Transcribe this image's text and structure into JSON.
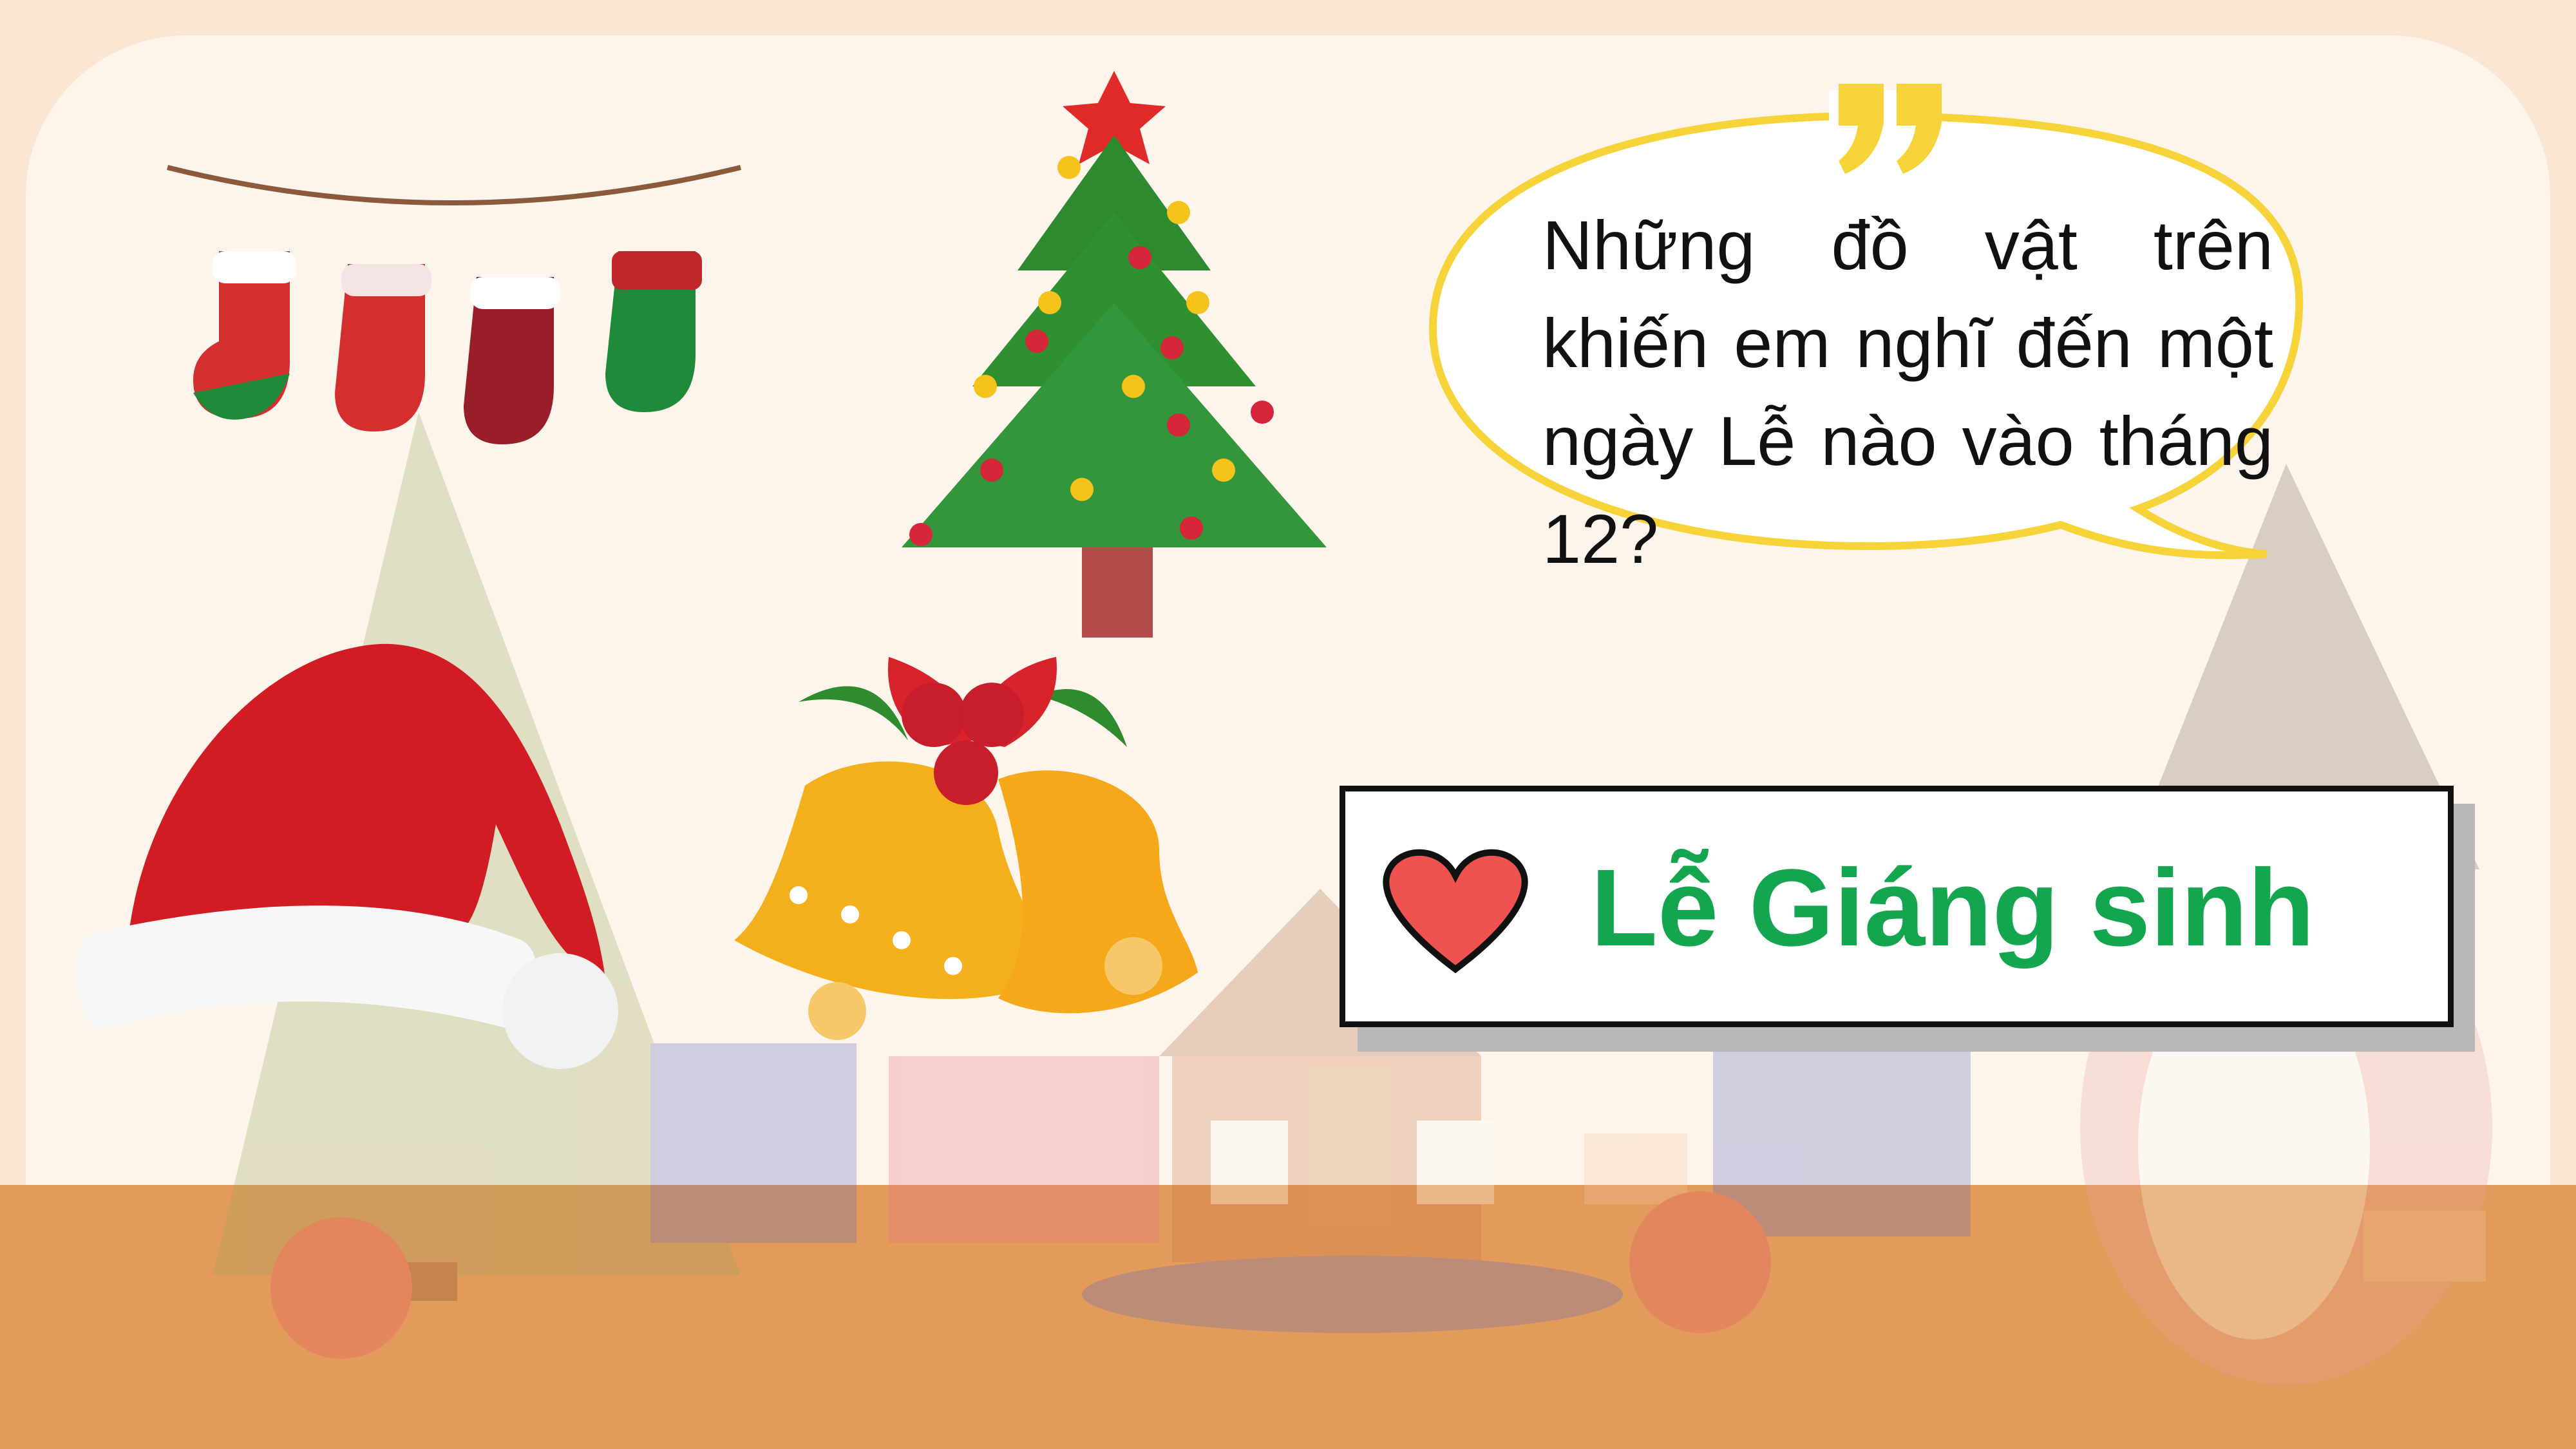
{
  "question": {
    "text": "Những đồ vật trên khiến em nghĩ đến một ngày Lễ nào vào tháng 12?"
  },
  "answer": {
    "text": "Lễ Giáng sinh"
  },
  "colors": {
    "answer_text": "#13a64f",
    "bubble_border": "#f7d33a",
    "heart": "#ef5350",
    "floor": "#e39b5c",
    "page_bg": "#fbe6d2"
  },
  "icons": [
    "christmas-stockings-icon",
    "christmas-tree-icon",
    "quote-mark-icon",
    "santa-hat-icon",
    "jingle-bells-icon",
    "heart-icon"
  ]
}
